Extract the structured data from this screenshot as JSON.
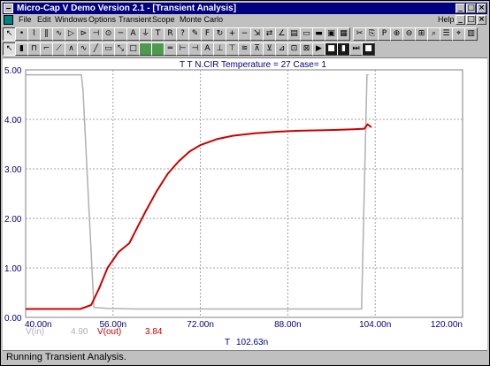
{
  "window": {
    "title": "Micro-Cap V Demo Version 2.1 - [Transient Analysis]",
    "buttons": [
      "_",
      "□",
      "×"
    ]
  },
  "menu": {
    "items": [
      "File",
      "Edit",
      "Windows",
      "Options",
      "Transient",
      "Scope",
      "Monte Carlo"
    ],
    "help": "Help",
    "doc_buttons": [
      "_",
      "□",
      "×"
    ]
  },
  "toolbar1": [
    "arrow-icon",
    "node-icon",
    "resistor-icon",
    "capacitor-icon",
    "inductor-icon",
    "diode-icon",
    "transistor-icon",
    "battery-icon",
    "source-icon",
    "wire-icon",
    "label-icon",
    "ground-icon",
    "text-icon",
    "rel-icon",
    "help-icon",
    "pencil-icon",
    "F",
    "rotate-icon",
    "plus-icon",
    "minus-icon",
    "scale-icon",
    "flip-icon",
    "angle-icon",
    "paste-icon",
    "window1-icon",
    "window2-icon",
    "window3-icon",
    "grid-icon",
    "sep",
    "cut-icon",
    "paste2-icon",
    "P",
    "zoom-in-icon",
    "zoom-out-icon",
    "grid2-icon",
    "find-icon",
    "table-icon",
    "scope-icon",
    "calc-icon"
  ],
  "toolbar2": {
    "items": [
      "select-icon",
      "bar-icon",
      "pulse-icon",
      "step-icon",
      "ramp-icon",
      "tri-icon",
      "sine-icon",
      "line-icon",
      "rect-icon",
      "diag-icon",
      "box-icon",
      "green-box-icon",
      "green-box2-icon",
      "dash-icon",
      "graph1-icon",
      "graph2-icon",
      "graph3-icon",
      "graph4-icon",
      "graph5-icon",
      "graph6-icon",
      "graph7-icon",
      "graph8-icon",
      "graph9-icon",
      "graph10-icon",
      "graph11-icon",
      "play-icon",
      "stop-icon",
      "pause-icon",
      "step2-icon",
      "end-icon"
    ]
  },
  "plot": {
    "header": "T  T  N.CIR  Temperature = 27  Case= 1",
    "cursor_label": "T",
    "cursor_value": "102.63n",
    "legend": [
      {
        "name": "V(in)",
        "value": "4.90",
        "color": "#b0b0b0"
      },
      {
        "name": "V(out)",
        "value": "3.84",
        "color": "#cc0000"
      }
    ],
    "axis_color": "#000080"
  },
  "chart_data": {
    "type": "line",
    "title": "T  T  N.CIR  Temperature = 27  Case= 1",
    "xlabel": "T",
    "ylabel": "",
    "xlim": [
      40,
      120
    ],
    "ylim": [
      0,
      5
    ],
    "x_ticks": [
      "40.00n",
      "56.00n",
      "72.00n",
      "88.00n",
      "104.00n",
      "120.00n"
    ],
    "y_ticks": [
      "0.00",
      "1.00",
      "2.00",
      "3.00",
      "4.00",
      "5.00"
    ],
    "grid": true,
    "series": [
      {
        "name": "V(in)",
        "color": "#b0b0b0",
        "x": [
          40,
          50.2,
          50.5,
          52.5,
          55,
          60,
          80,
          100,
          101.5,
          102.5,
          102.8
        ],
        "y": [
          4.9,
          4.9,
          4.6,
          0.2,
          0.18,
          0.17,
          0.17,
          0.17,
          0.17,
          4.9,
          4.9
        ]
      },
      {
        "name": "V(out)",
        "color": "#cc0000",
        "x": [
          40,
          50,
          52,
          53.5,
          55,
          57,
          59,
          60,
          62,
          64,
          66,
          68,
          70,
          72,
          75,
          78,
          82,
          86,
          90,
          95,
          100,
          102,
          102.6,
          103.3
        ],
        "y": [
          0.17,
          0.17,
          0.25,
          0.6,
          1.0,
          1.32,
          1.5,
          1.72,
          2.15,
          2.55,
          2.9,
          3.15,
          3.35,
          3.48,
          3.6,
          3.67,
          3.72,
          3.75,
          3.77,
          3.78,
          3.8,
          3.81,
          3.9,
          3.84
        ]
      }
    ]
  },
  "status": "Running Transient Analysis."
}
